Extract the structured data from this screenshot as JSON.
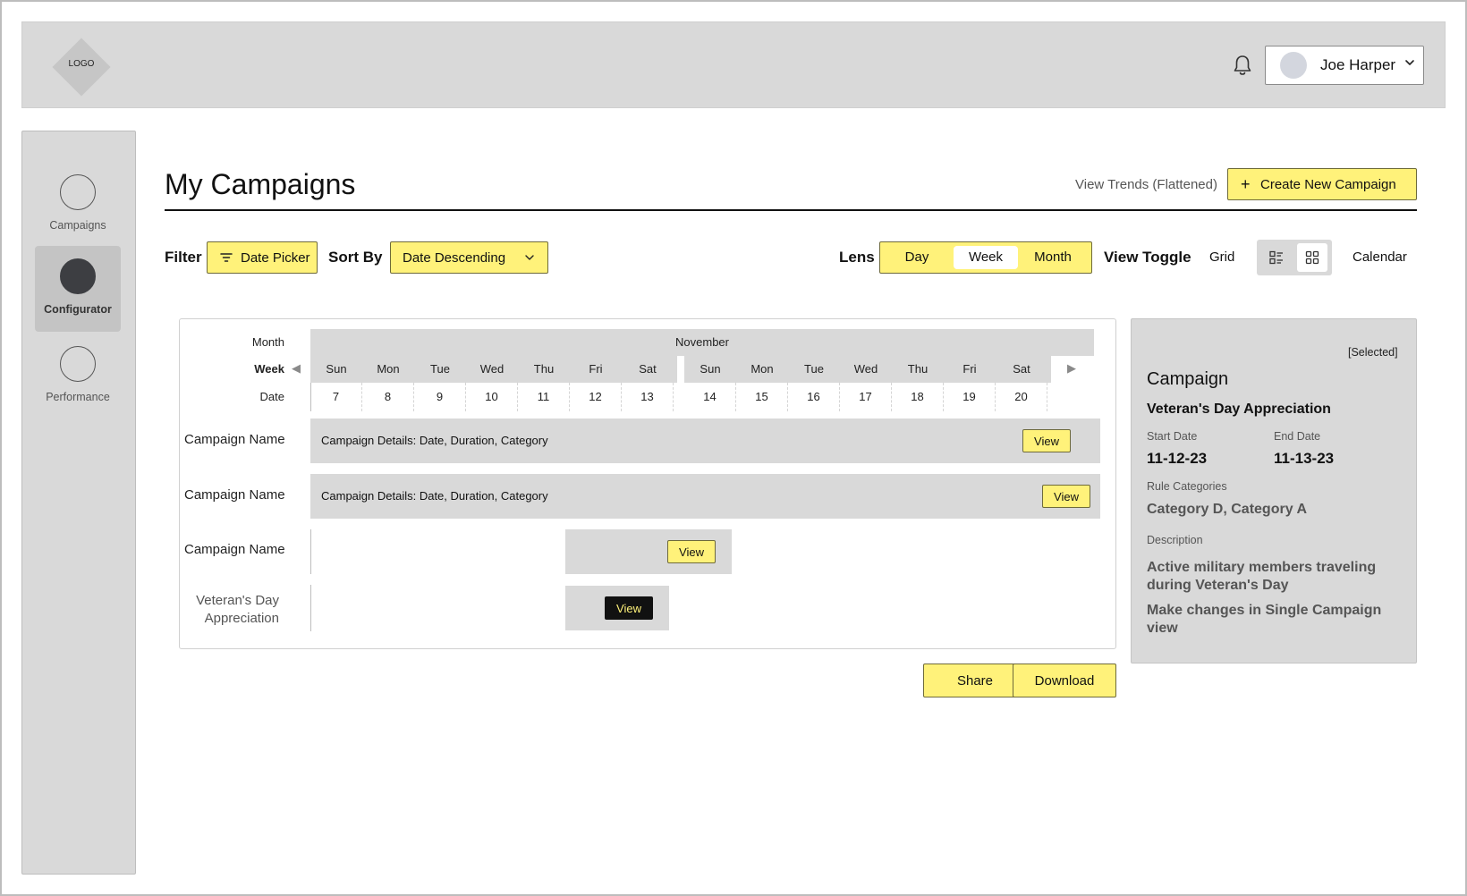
{
  "header": {
    "logo_text": "LOGO",
    "user_name": "Joe Harper"
  },
  "sidebar": {
    "items": [
      {
        "label": "Campaigns"
      },
      {
        "label": "Configurator"
      },
      {
        "label": "Performance"
      }
    ]
  },
  "page": {
    "title": "My Campaigns",
    "trends_link": "View Trends (Flattened)",
    "create_button": "Create New Campaign"
  },
  "controls": {
    "filter_label": "Filter",
    "date_picker": "Date Picker",
    "sort_label": "Sort By",
    "sort_value": "Date Descending",
    "lens_label": "Lens",
    "lens_options": [
      "Day",
      "Week",
      "Month"
    ],
    "lens_selected": "Week",
    "view_toggle_label": "View Toggle",
    "grid_label": "Grid",
    "calendar_label": "Calendar"
  },
  "calendar": {
    "month_label": "Month",
    "week_label": "Week",
    "date_label": "Date",
    "month_name": "November",
    "weeks": [
      {
        "days": [
          "Sun",
          "Mon",
          "Tue",
          "Wed",
          "Thu",
          "Fri",
          "Sat"
        ],
        "dates": [
          "7",
          "8",
          "9",
          "10",
          "11",
          "12",
          "13"
        ]
      },
      {
        "days": [
          "Sun",
          "Mon",
          "Tue",
          "Wed",
          "Thu",
          "Fri",
          "Sat"
        ],
        "dates": [
          "14",
          "15",
          "16",
          "17",
          "18",
          "19",
          "20"
        ]
      }
    ],
    "rows": [
      {
        "name": "Campaign Name",
        "details": "Campaign Details: Date, Duration, Category",
        "view": "View"
      },
      {
        "name": "Campaign Name",
        "details": "Campaign Details: Date, Duration, Category",
        "view": "View"
      },
      {
        "name": "Campaign Name",
        "details": "",
        "view": "View"
      },
      {
        "name": "Veteran's Day Appreciation",
        "details": "",
        "view": "View"
      }
    ]
  },
  "actions": {
    "share": "Share",
    "download": "Download"
  },
  "detail": {
    "selected_tag": "[Selected]",
    "heading": "Campaign",
    "name": "Veteran's Day Appreciation",
    "start_label": "Start Date",
    "start_value": "11-12-23",
    "end_label": "End Date",
    "end_value": "11-13-23",
    "rule_label": "Rule Categories",
    "rule_value": "Category D,  Category A",
    "desc_label": "Description",
    "desc_text": "Active military members traveling during Veteran's Day",
    "desc_note": "Make changes in Single Campaign view"
  },
  "colors": {
    "accent_yellow": "#fff27a",
    "panel_gray": "#d9d9d9"
  }
}
